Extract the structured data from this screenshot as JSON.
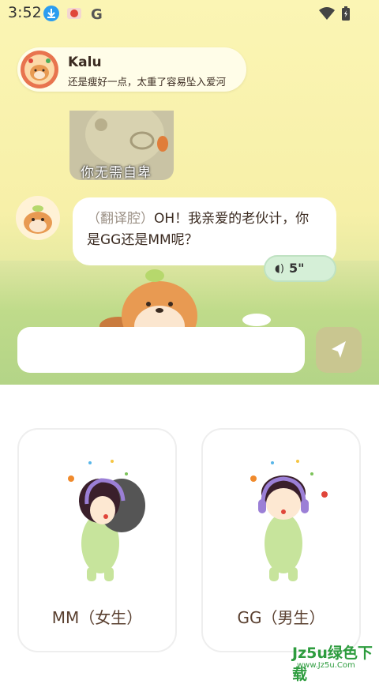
{
  "status_bar": {
    "time": "3:52",
    "icons": [
      "download-icon",
      "app-icon",
      "google-icon",
      "wifi-icon",
      "battery-icon"
    ]
  },
  "chat": {
    "contact_name": "Kalu",
    "contact_subtitle": "还是瘦好一点，太重了容易坠入爱河",
    "sticker_caption": "你无需自卑",
    "message_prefix": "（翻译腔）",
    "message_text": "OH！我亲爱的老伙计，你是GG还是MM呢？",
    "voice_duration": "5\"",
    "input_placeholder": ""
  },
  "choices": [
    {
      "label": "MM（女生）"
    },
    {
      "label": "GG（男生）"
    }
  ],
  "watermark": {
    "text": "Jz5u绿色下载",
    "url_text": "www.Jz5u.Com"
  },
  "colors": {
    "accent_send": "#c9c690",
    "voice_bg": "#d5efd7",
    "text_brown": "#5a4030"
  }
}
